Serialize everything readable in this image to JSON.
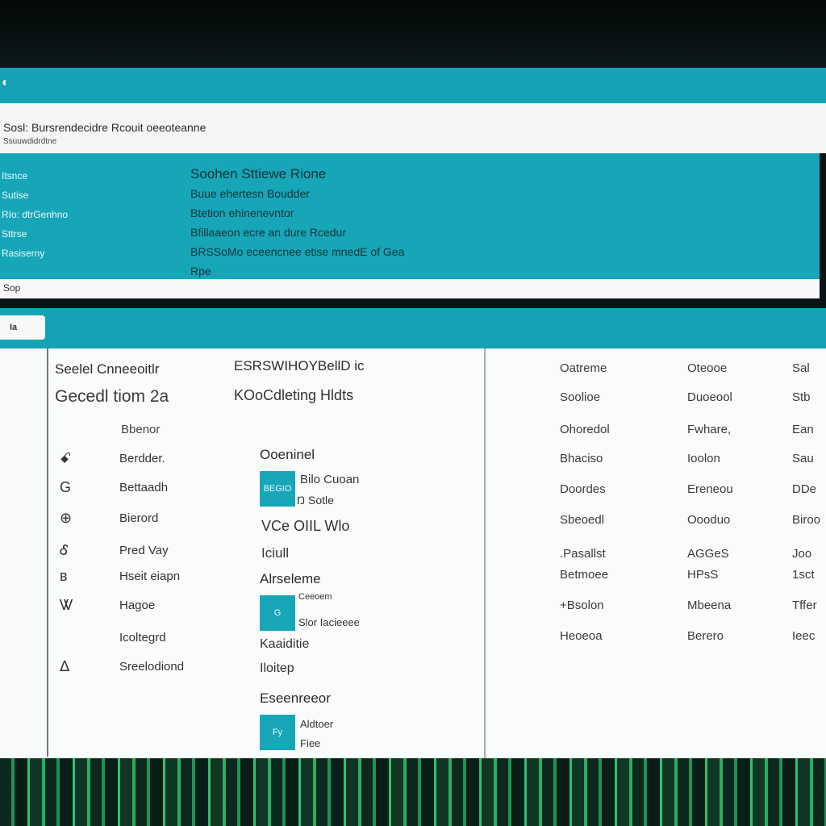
{
  "window": {
    "title_icon": "app-icon",
    "header_line1": "Sosl: Bursrendecidre Rcouit oeeoteanne",
    "header_line2": "Ssuuwdidrdtne"
  },
  "info": {
    "left": [
      "Itsnce",
      "Sutise",
      "RIo: dtrGenhno",
      "Sttrse",
      "Rasiserny"
    ],
    "right": [
      "Soohen Sttiewe Rione",
      "Buue ehertesn Boudder",
      "Btetion ehinenevntor",
      "Bfillaaeon ecre an dure Rcedur",
      "BRSSoMo eceencnee etise mnedE of Gea",
      "Rpe"
    ]
  },
  "url_text": "Sop",
  "toolbar": {
    "tab_label": "Ia"
  },
  "panel_a": {
    "title": "Seelel Cnneeoitlr",
    "subtitle": "Gecedl tiom 2a",
    "column_head": "Bbenor",
    "items": [
      {
        "icon": "person-icon",
        "glyph": "ꗃ",
        "label": "Berdder."
      },
      {
        "icon": "g-letter-icon",
        "glyph": "G",
        "label": "Bettaadh"
      },
      {
        "icon": "globe-icon",
        "glyph": "⊕",
        "label": "Bierord"
      },
      {
        "icon": "user-icon",
        "glyph": "Ꮄ",
        "label": "Pred Vay"
      },
      {
        "icon": "small-dot-icon",
        "glyph": "ʙ",
        "label": "Hseit eiapn"
      },
      {
        "icon": "badge-icon",
        "glyph": "Ꮤ",
        "label": "Hagoe"
      },
      {
        "icon": "blank-icon",
        "glyph": "",
        "label": "Icoltegrd"
      },
      {
        "icon": "pin-icon",
        "glyph": "ᐃ",
        "label": "Sreelodiond"
      }
    ]
  },
  "panel_b": {
    "title": "ESRSWIHOYBellD ic",
    "subtitle": "KOoCdleting Hldts",
    "sections": [
      {
        "title": "Ooeninel",
        "thumb_label": "BEGIO",
        "lines": [
          "Bilo Cuoan",
          "Ŋ Sotle"
        ]
      },
      {
        "title": "Alrseleme",
        "thumb_label": "G",
        "lines": [
          "Ceeoem",
          "Slor Iacieeee"
        ]
      },
      {
        "title": "Eseenreeor",
        "thumb_label": "Fy",
        "lines": [
          "Aldtoer",
          "Fiee"
        ]
      }
    ],
    "extra_lines": [
      "VCe OIIL Wlo",
      "Iciull",
      "Kaaiditie",
      "Iloitep"
    ]
  },
  "panel_c": {
    "columns": [
      [
        "Oatreme",
        "Soolioe",
        "Ohoredol",
        "Bhaciso",
        "Doordes",
        "Sbeoedl",
        ".Pasallst",
        "Betmoee",
        "+Bsolon",
        "Heoeoa"
      ],
      [
        "Oteooe",
        "Duoeool",
        "Fwhare,",
        "Ioolon",
        "Ereneou",
        "Oooduo",
        "AGGeS",
        "HPsS",
        "Mbeena",
        "Berero"
      ],
      [
        "Sal",
        "Stb",
        "Ean",
        "Sau",
        "DDe",
        "Biroo",
        "Joo",
        "1sct",
        "Tffer",
        "Ieec"
      ]
    ]
  },
  "colors": {
    "accent": "#14a3b4",
    "panel": "#f8f9f9",
    "border": "#6d7a7b"
  }
}
